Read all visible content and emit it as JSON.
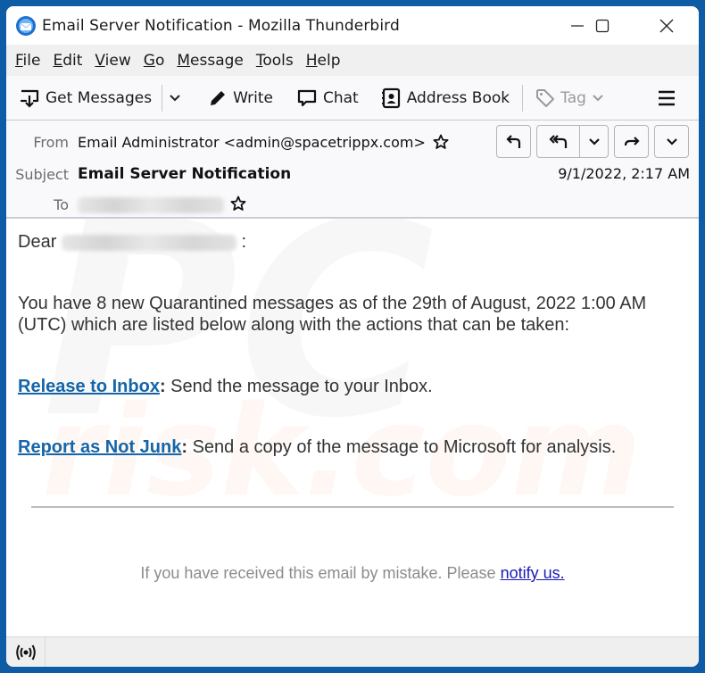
{
  "window": {
    "title": "Email Server Notification - Mozilla Thunderbird",
    "icon": "thunderbird-logo-icon",
    "controls": [
      "minimize-icon",
      "maximize-icon",
      "close-icon"
    ]
  },
  "menubar": {
    "items": [
      {
        "label": "File",
        "accel": "F",
        "rest": "ile"
      },
      {
        "label": "Edit",
        "accel": "E",
        "rest": "dit"
      },
      {
        "label": "View",
        "accel": "V",
        "rest": "iew"
      },
      {
        "label": "Go",
        "accel": "G",
        "rest": "o"
      },
      {
        "label": "Message",
        "accel": "M",
        "rest": "essage"
      },
      {
        "label": "Tools",
        "accel": "T",
        "rest": "ools"
      },
      {
        "label": "Help",
        "accel": "H",
        "rest": "elp"
      }
    ]
  },
  "toolbar": {
    "get_messages": "Get Messages",
    "write": "Write",
    "chat": "Chat",
    "address_book": "Address Book",
    "tag": "Tag"
  },
  "header": {
    "from_label": "From",
    "from_value": "Email Administrator <admin@spacetrippx.com>",
    "subject_label": "Subject",
    "subject_value": "Email Server Notification",
    "to_label": "To",
    "to_value": "[redacted]",
    "date": "9/1/2022, 2:17 AM",
    "buttons": [
      "reply-icon",
      "reply-all-icon",
      "reply-all-dropdown-icon",
      "forward-icon",
      "more-dropdown-icon"
    ]
  },
  "message": {
    "greeting": "Dear",
    "greeting_suffix": ":",
    "paragraph1": "You have 8 new Quarantined messages as of the 29th of August, 2022 1:00 AM (UTC) which are listed below along with the actions that can be taken:",
    "action1_link": "Release to Inbox",
    "action1_text": ": Send the message to your Inbox.",
    "action2_link": "Report as Not Junk",
    "action2_text": ": Send a copy of the message to Microsoft for analysis.",
    "footer_text": "If you have received this email by mistake. Please ",
    "footer_link": "notify us."
  },
  "watermark": {
    "text1": "PC",
    "text2": "risk.com"
  },
  "colors": {
    "window_border": "#0f5ca6",
    "link": "#1565a8",
    "footer_link": "#1a1ab8"
  }
}
